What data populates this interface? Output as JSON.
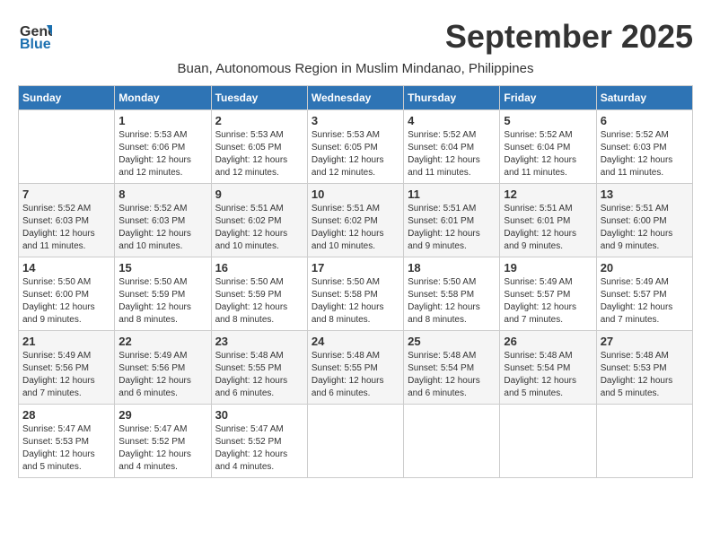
{
  "logo": {
    "line1": "General",
    "line2": "Blue"
  },
  "title": "September 2025",
  "subtitle": "Buan, Autonomous Region in Muslim Mindanao, Philippines",
  "headers": [
    "Sunday",
    "Monday",
    "Tuesday",
    "Wednesday",
    "Thursday",
    "Friday",
    "Saturday"
  ],
  "weeks": [
    [
      {
        "day": "",
        "info": ""
      },
      {
        "day": "1",
        "info": "Sunrise: 5:53 AM\nSunset: 6:06 PM\nDaylight: 12 hours\nand 12 minutes."
      },
      {
        "day": "2",
        "info": "Sunrise: 5:53 AM\nSunset: 6:05 PM\nDaylight: 12 hours\nand 12 minutes."
      },
      {
        "day": "3",
        "info": "Sunrise: 5:53 AM\nSunset: 6:05 PM\nDaylight: 12 hours\nand 12 minutes."
      },
      {
        "day": "4",
        "info": "Sunrise: 5:52 AM\nSunset: 6:04 PM\nDaylight: 12 hours\nand 11 minutes."
      },
      {
        "day": "5",
        "info": "Sunrise: 5:52 AM\nSunset: 6:04 PM\nDaylight: 12 hours\nand 11 minutes."
      },
      {
        "day": "6",
        "info": "Sunrise: 5:52 AM\nSunset: 6:03 PM\nDaylight: 12 hours\nand 11 minutes."
      }
    ],
    [
      {
        "day": "7",
        "info": "Sunrise: 5:52 AM\nSunset: 6:03 PM\nDaylight: 12 hours\nand 11 minutes."
      },
      {
        "day": "8",
        "info": "Sunrise: 5:52 AM\nSunset: 6:03 PM\nDaylight: 12 hours\nand 10 minutes."
      },
      {
        "day": "9",
        "info": "Sunrise: 5:51 AM\nSunset: 6:02 PM\nDaylight: 12 hours\nand 10 minutes."
      },
      {
        "day": "10",
        "info": "Sunrise: 5:51 AM\nSunset: 6:02 PM\nDaylight: 12 hours\nand 10 minutes."
      },
      {
        "day": "11",
        "info": "Sunrise: 5:51 AM\nSunset: 6:01 PM\nDaylight: 12 hours\nand 9 minutes."
      },
      {
        "day": "12",
        "info": "Sunrise: 5:51 AM\nSunset: 6:01 PM\nDaylight: 12 hours\nand 9 minutes."
      },
      {
        "day": "13",
        "info": "Sunrise: 5:51 AM\nSunset: 6:00 PM\nDaylight: 12 hours\nand 9 minutes."
      }
    ],
    [
      {
        "day": "14",
        "info": "Sunrise: 5:50 AM\nSunset: 6:00 PM\nDaylight: 12 hours\nand 9 minutes."
      },
      {
        "day": "15",
        "info": "Sunrise: 5:50 AM\nSunset: 5:59 PM\nDaylight: 12 hours\nand 8 minutes."
      },
      {
        "day": "16",
        "info": "Sunrise: 5:50 AM\nSunset: 5:59 PM\nDaylight: 12 hours\nand 8 minutes."
      },
      {
        "day": "17",
        "info": "Sunrise: 5:50 AM\nSunset: 5:58 PM\nDaylight: 12 hours\nand 8 minutes."
      },
      {
        "day": "18",
        "info": "Sunrise: 5:50 AM\nSunset: 5:58 PM\nDaylight: 12 hours\nand 8 minutes."
      },
      {
        "day": "19",
        "info": "Sunrise: 5:49 AM\nSunset: 5:57 PM\nDaylight: 12 hours\nand 7 minutes."
      },
      {
        "day": "20",
        "info": "Sunrise: 5:49 AM\nSunset: 5:57 PM\nDaylight: 12 hours\nand 7 minutes."
      }
    ],
    [
      {
        "day": "21",
        "info": "Sunrise: 5:49 AM\nSunset: 5:56 PM\nDaylight: 12 hours\nand 7 minutes."
      },
      {
        "day": "22",
        "info": "Sunrise: 5:49 AM\nSunset: 5:56 PM\nDaylight: 12 hours\nand 6 minutes."
      },
      {
        "day": "23",
        "info": "Sunrise: 5:48 AM\nSunset: 5:55 PM\nDaylight: 12 hours\nand 6 minutes."
      },
      {
        "day": "24",
        "info": "Sunrise: 5:48 AM\nSunset: 5:55 PM\nDaylight: 12 hours\nand 6 minutes."
      },
      {
        "day": "25",
        "info": "Sunrise: 5:48 AM\nSunset: 5:54 PM\nDaylight: 12 hours\nand 6 minutes."
      },
      {
        "day": "26",
        "info": "Sunrise: 5:48 AM\nSunset: 5:54 PM\nDaylight: 12 hours\nand 5 minutes."
      },
      {
        "day": "27",
        "info": "Sunrise: 5:48 AM\nSunset: 5:53 PM\nDaylight: 12 hours\nand 5 minutes."
      }
    ],
    [
      {
        "day": "28",
        "info": "Sunrise: 5:47 AM\nSunset: 5:53 PM\nDaylight: 12 hours\nand 5 minutes."
      },
      {
        "day": "29",
        "info": "Sunrise: 5:47 AM\nSunset: 5:52 PM\nDaylight: 12 hours\nand 4 minutes."
      },
      {
        "day": "30",
        "info": "Sunrise: 5:47 AM\nSunset: 5:52 PM\nDaylight: 12 hours\nand 4 minutes."
      },
      {
        "day": "",
        "info": ""
      },
      {
        "day": "",
        "info": ""
      },
      {
        "day": "",
        "info": ""
      },
      {
        "day": "",
        "info": ""
      }
    ]
  ]
}
